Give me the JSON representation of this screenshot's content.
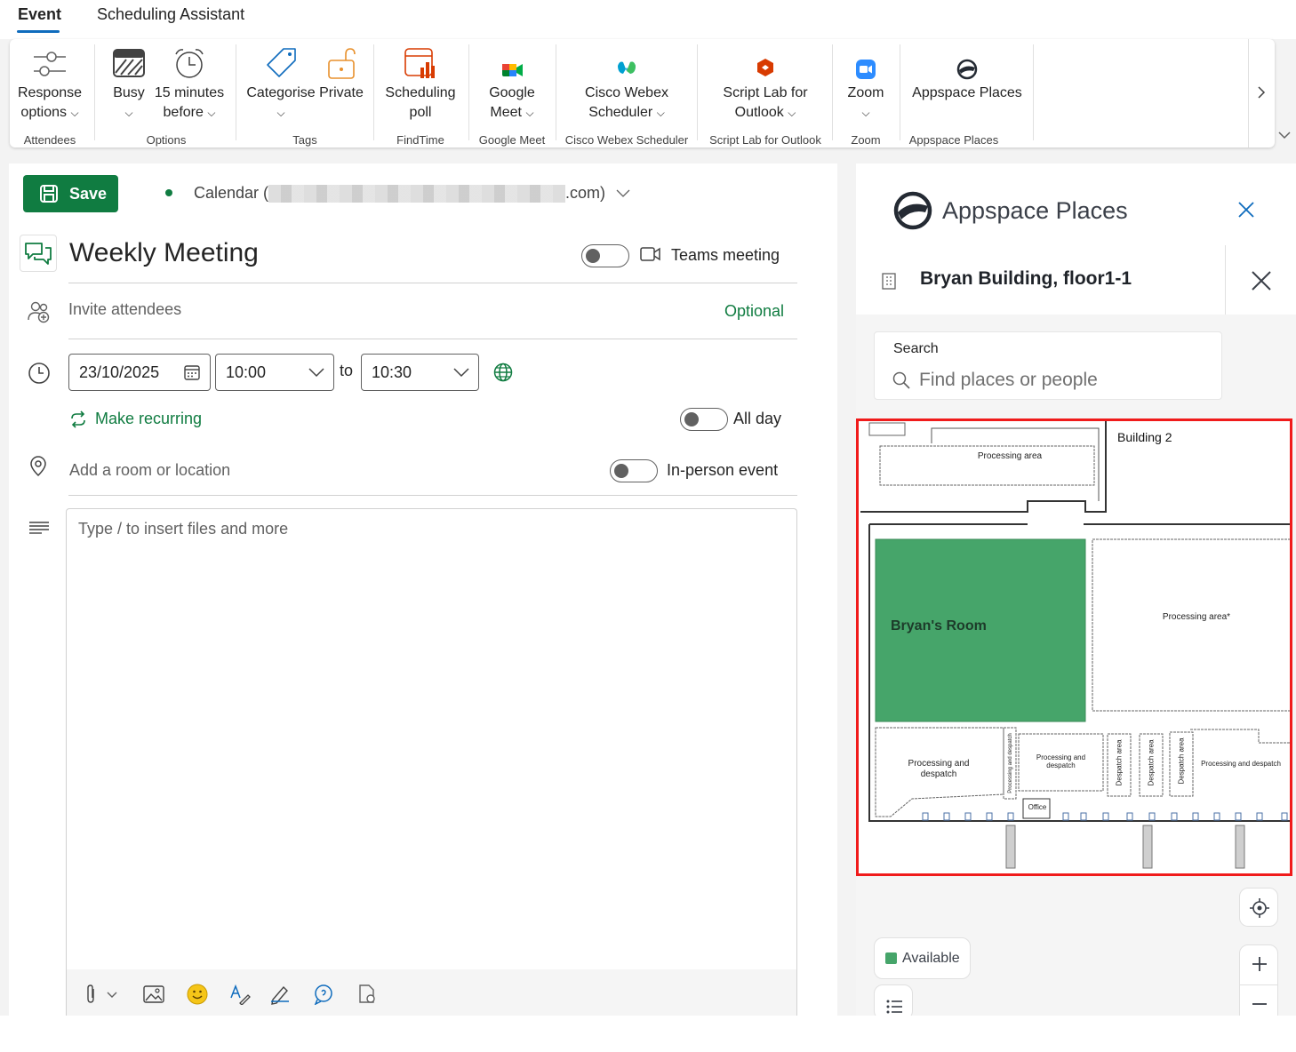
{
  "tabs": [
    {
      "label": "Event",
      "active": true
    },
    {
      "label": "Scheduling Assistant",
      "active": false
    }
  ],
  "ribbon": {
    "groups": [
      {
        "label": "Attendees",
        "buttons": [
          {
            "line1": "Response",
            "line2": "options",
            "icon": "response-options-icon"
          }
        ]
      },
      {
        "label": "Options",
        "buttons": [
          {
            "line1": "Busy",
            "icon": "busy-icon"
          },
          {
            "line1": "15 minutes",
            "line2": "before",
            "icon": "alarm-clock-icon"
          }
        ]
      },
      {
        "label": "Tags",
        "buttons": [
          {
            "line1": "Categorise",
            "icon": "tag-icon"
          },
          {
            "line1": "Private",
            "icon": "lock-icon"
          }
        ]
      },
      {
        "label": "FindTime",
        "buttons": [
          {
            "line1": "Scheduling",
            "line2": "poll",
            "icon": "scheduling-poll-icon"
          }
        ]
      },
      {
        "label": "Google Meet",
        "buttons": [
          {
            "line1": "Google",
            "line2": "Meet",
            "icon": "google-meet-icon"
          }
        ]
      },
      {
        "label": "Cisco Webex Scheduler",
        "buttons": [
          {
            "line1": "Cisco Webex",
            "line2": "Scheduler",
            "icon": "webex-icon"
          }
        ]
      },
      {
        "label": "Script Lab for Outlook",
        "buttons": [
          {
            "line1": "Script Lab for",
            "line2": "Outlook",
            "icon": "script-lab-icon"
          }
        ]
      },
      {
        "label": "Zoom",
        "buttons": [
          {
            "line1": "Zoom",
            "icon": "zoom-icon"
          }
        ]
      },
      {
        "label": "Appspace Places",
        "buttons": [
          {
            "line1": "Appspace Places",
            "icon": "appspace-icon"
          }
        ]
      }
    ]
  },
  "form": {
    "save_label": "Save",
    "calendar_prefix": "Calendar (",
    "calendar_suffix": ".com)",
    "title_value": "Weekly Meeting",
    "teams_label": "Teams meeting",
    "invite_placeholder": "Invite attendees",
    "optional_label": "Optional",
    "start_date": "23/10/2025",
    "start_time": "10:00",
    "to_label": "to",
    "end_time": "10:30",
    "recurring_label": "Make recurring",
    "all_day_label": "All day",
    "location_placeholder": "Add a room or location",
    "in_person_label": "In-person event",
    "body_placeholder": "Type / to insert files and more"
  },
  "panel": {
    "title": "Appspace Places",
    "building": "Bryan Building, floor1-1",
    "search_label": "Search",
    "search_placeholder": "Find places or people",
    "available_label": "Available"
  },
  "map": {
    "building_label": "Building  2",
    "rooms": [
      {
        "label": "Processing area"
      },
      {
        "label": "Bryan's Room",
        "status": "available"
      },
      {
        "label": "Processing area*"
      },
      {
        "label": "Processing and despatch"
      },
      {
        "label": "Processing and despatch"
      },
      {
        "label": "Processing and despatch"
      },
      {
        "label": "Despatch area"
      },
      {
        "label": "Despatch area"
      },
      {
        "label": "Despatch area"
      },
      {
        "label": "Processing and despatch"
      },
      {
        "label": "Office"
      }
    ]
  },
  "colors": {
    "brand_green": "#107c41",
    "room_available": "#46a56a",
    "accent_blue": "#0f6cbd",
    "highlight_red": "#f01b1b"
  }
}
